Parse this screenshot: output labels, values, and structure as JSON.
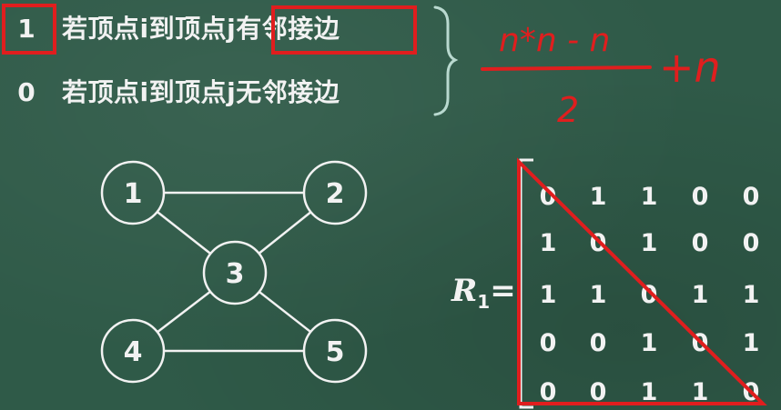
{
  "definitions": [
    {
      "value": "1",
      "text": "若顶点i到顶点j有邻接边"
    },
    {
      "value": "0",
      "text": "若顶点i到顶点j无邻接边"
    }
  ],
  "annotation": {
    "numerator": "n*n - n",
    "denominator": "2",
    "tail": "+n"
  },
  "graph": {
    "nodes": [
      {
        "id": "1",
        "label": "1"
      },
      {
        "id": "2",
        "label": "2"
      },
      {
        "id": "3",
        "label": "3"
      },
      {
        "id": "4",
        "label": "4"
      },
      {
        "id": "5",
        "label": "5"
      }
    ],
    "edges": [
      [
        "1",
        "2"
      ],
      [
        "1",
        "3"
      ],
      [
        "2",
        "3"
      ],
      [
        "3",
        "4"
      ],
      [
        "3",
        "5"
      ],
      [
        "4",
        "5"
      ]
    ]
  },
  "matrix": {
    "label": "R",
    "subscript": "1",
    "equals": "=",
    "rows": [
      [
        "0",
        "1",
        "1",
        "0",
        "0"
      ],
      [
        "1",
        "0",
        "1",
        "0",
        "0"
      ],
      [
        "1",
        "1",
        "0",
        "1",
        "1"
      ],
      [
        "0",
        "0",
        "1",
        "0",
        "1"
      ],
      [
        "0",
        "0",
        "1",
        "1",
        "0"
      ]
    ]
  },
  "colors": {
    "board": "#2f5a48",
    "chalk": "#f2f2f2",
    "highlight": "#e01e1e",
    "brace": "#b9d9cf"
  }
}
